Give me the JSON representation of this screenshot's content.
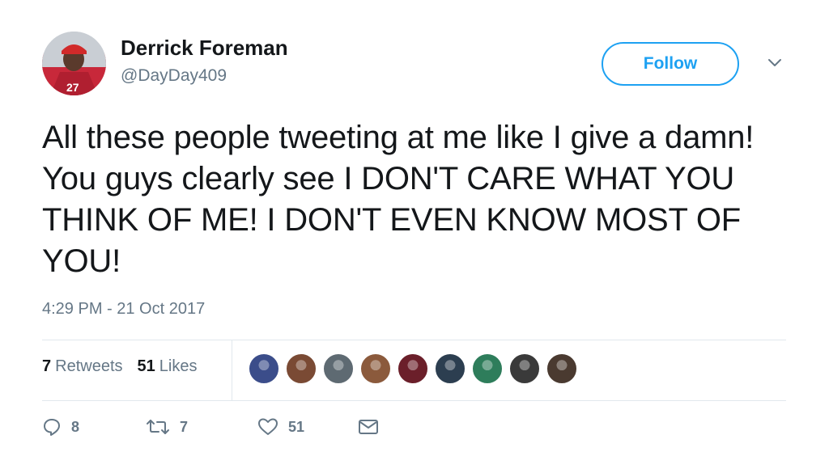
{
  "tweet": {
    "author": {
      "name": "Derrick Foreman",
      "handle": "@DayDay409"
    },
    "follow_label": "Follow",
    "text": "All these people tweeting at me like I give a damn! You guys clearly see I DON'T CARE WHAT YOU THINK OF ME! I DON'T EVEN KNOW MOST OF YOU!",
    "timestamp": "4:29 PM - 21 Oct 2017",
    "stats": {
      "retweets_count": "7",
      "retweets_label": "Retweets",
      "likes_count": "51",
      "likes_label": "Likes"
    },
    "likers": [
      {
        "color": "#3b4d8a"
      },
      {
        "color": "#7a4a34"
      },
      {
        "color": "#5e6a72"
      },
      {
        "color": "#8b5a3c"
      },
      {
        "color": "#6b1f2a"
      },
      {
        "color": "#2c3e50"
      },
      {
        "color": "#2e7d5b"
      },
      {
        "color": "#3a3a3a"
      },
      {
        "color": "#4a3a30"
      }
    ],
    "actions": {
      "reply_count": "8",
      "retweet_count": "7",
      "like_count": "51"
    },
    "colors": {
      "accent": "#1da1f2",
      "muted": "#657786",
      "text": "#14171a",
      "divider": "#e1e8ed"
    }
  }
}
